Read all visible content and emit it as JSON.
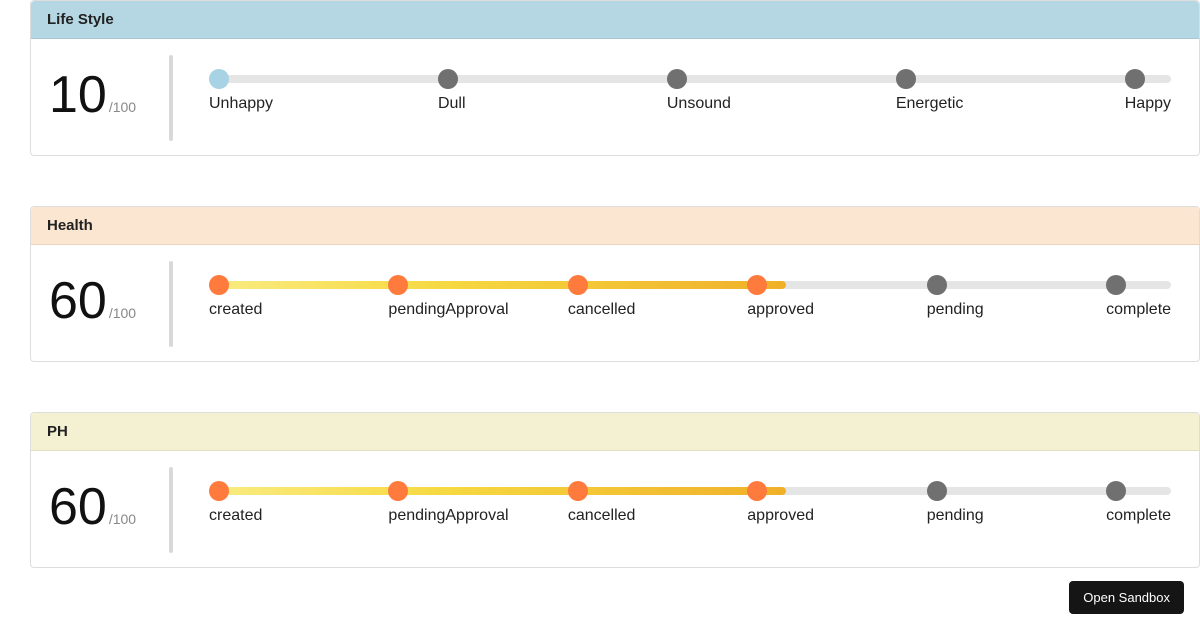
{
  "cards": [
    {
      "title": "Life Style",
      "score": "10",
      "score_suffix": "/100",
      "fill_pct": 0,
      "active_count": 1,
      "dot_style": "blue",
      "steps": [
        "Unhappy",
        "Dull",
        "Unsound",
        "Energetic",
        "Happy"
      ]
    },
    {
      "title": "Health",
      "score": "60",
      "score_suffix": "/100",
      "fill_pct": 60,
      "active_count": 4,
      "dot_style": "orange",
      "steps": [
        "created",
        "pendingApproval",
        "cancelled",
        "approved",
        "pending",
        "complete"
      ]
    },
    {
      "title": "PH",
      "score": "60",
      "score_suffix": "/100",
      "fill_pct": 60,
      "active_count": 4,
      "dot_style": "orange",
      "steps": [
        "created",
        "pendingApproval",
        "cancelled",
        "approved",
        "pending",
        "complete"
      ]
    }
  ],
  "header_classes": [
    "hdr-blue",
    "hdr-peach",
    "hdr-cream"
  ],
  "sandbox_label": "Open Sandbox"
}
